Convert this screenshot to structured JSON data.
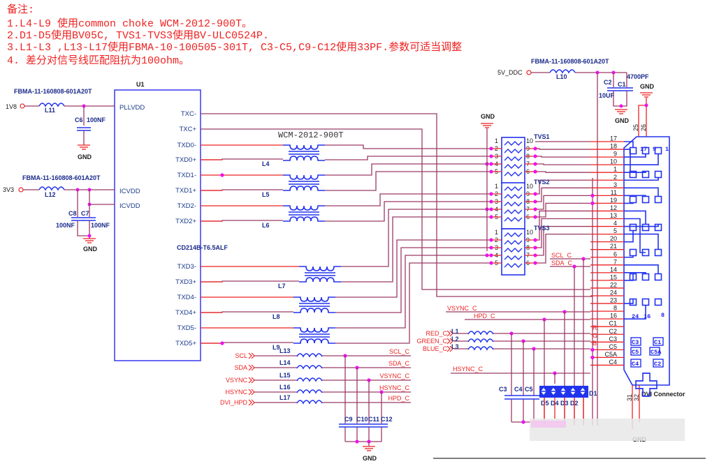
{
  "notes": {
    "title": "备注:",
    "lines": [
      "1.L4-L9 使用common choke WCM-2012-900T。",
      "2.D1-D5使用BV05C, TVS1-TVS3使用BV-ULC0524P.",
      "3.L1-L3 ,L13-L17使用FBMA-10-100505-301T, C3-C5,C9-C12使用33PF.参数可适当调整",
      "4. 差分对信号线匹配阻抗为100ohm。"
    ]
  },
  "u1": {
    "ref": "U1",
    "part": "CD214B-T6.5ALF",
    "left_pins": [
      "PLLVDD",
      "ICVDD",
      "ICVDD"
    ],
    "right_pins": [
      "TXC-",
      "TXC+",
      "TXD0-",
      "TXD0+",
      "TXD1-",
      "TXD1+",
      "TXD2-",
      "TXD2+",
      "TXD3-",
      "TXD3+",
      "TXD4-",
      "TXD4+",
      "TXD5-",
      "TXD5+"
    ]
  },
  "power": {
    "v1": "1V8",
    "v2": "3V3",
    "v3": "5V_DDC",
    "ferrite": "FBMA-11-160808-601A20T",
    "l11": "L11",
    "l12": "L12",
    "l10": "L10",
    "c6": "C6",
    "c6v": "100NF",
    "c8": "C8",
    "c7": "C7",
    "c8v": "100NF",
    "c7v": "100NF",
    "c2": "C2",
    "c1": "C1",
    "c2v": "10UF",
    "c1v": "4700PF",
    "gnd": "GND"
  },
  "chokes": {
    "part": "WCM-2012-900T",
    "refs": [
      "L4",
      "L5",
      "L6",
      "L7",
      "L8",
      "L9"
    ]
  },
  "tvs": {
    "refs": [
      "TVS1",
      "TVS2",
      "TVS3"
    ],
    "left_pins": [
      "1",
      "2",
      "3",
      "4",
      "5"
    ],
    "right_pins": [
      "10",
      "9",
      "8",
      "7",
      "6"
    ]
  },
  "ddc": {
    "inputs": [
      "SCL",
      "SDA",
      "VSYNC",
      "HSYNC",
      "DVI_HPD"
    ],
    "refs": [
      "L13",
      "L14",
      "L15",
      "L16",
      "L17"
    ],
    "outputs": [
      "SCL_C",
      "SDA_C",
      "VSYNC_C",
      "HSYNC_C",
      "HPD_C"
    ],
    "caps": [
      "C9",
      "C10",
      "C11",
      "C12"
    ]
  },
  "rgb": {
    "inputs": [
      "RED_C",
      "GREEN_C",
      "BLUE_C"
    ],
    "refs": [
      "L1",
      "L2",
      "L3"
    ],
    "letters": [
      "R",
      "G",
      "B"
    ],
    "caps": [
      "C3",
      "C4",
      "C5"
    ],
    "diodes": [
      "D5",
      "D4",
      "D3",
      "D2",
      "D1"
    ]
  },
  "mid_labels": {
    "scl": "SCL_C",
    "sda": "SDA_C",
    "vsync": "VSYNC_C",
    "hpd": "HPD_C",
    "hsync": "HSYNC_C"
  },
  "connector": {
    "name": "DVI Connector",
    "pins": [
      "17",
      "18",
      "9",
      "10",
      "1",
      "2",
      "3",
      "11",
      "19",
      "12",
      "13",
      "4",
      "5",
      "20",
      "21",
      "6",
      "7",
      "14",
      "15",
      "22",
      "24",
      "23",
      "8",
      "16",
      "C1",
      "C2",
      "C3",
      "C5",
      "C5A",
      "C4"
    ],
    "top_pins": [
      "25",
      "26"
    ],
    "bottom_pins": [
      "31",
      "32"
    ],
    "inner_labels": [
      "17",
      "9",
      "1",
      "24",
      "16",
      "8"
    ],
    "analog_labels": [
      "C3",
      "C1",
      "C5",
      "C5A",
      "C4",
      "C2"
    ]
  }
}
